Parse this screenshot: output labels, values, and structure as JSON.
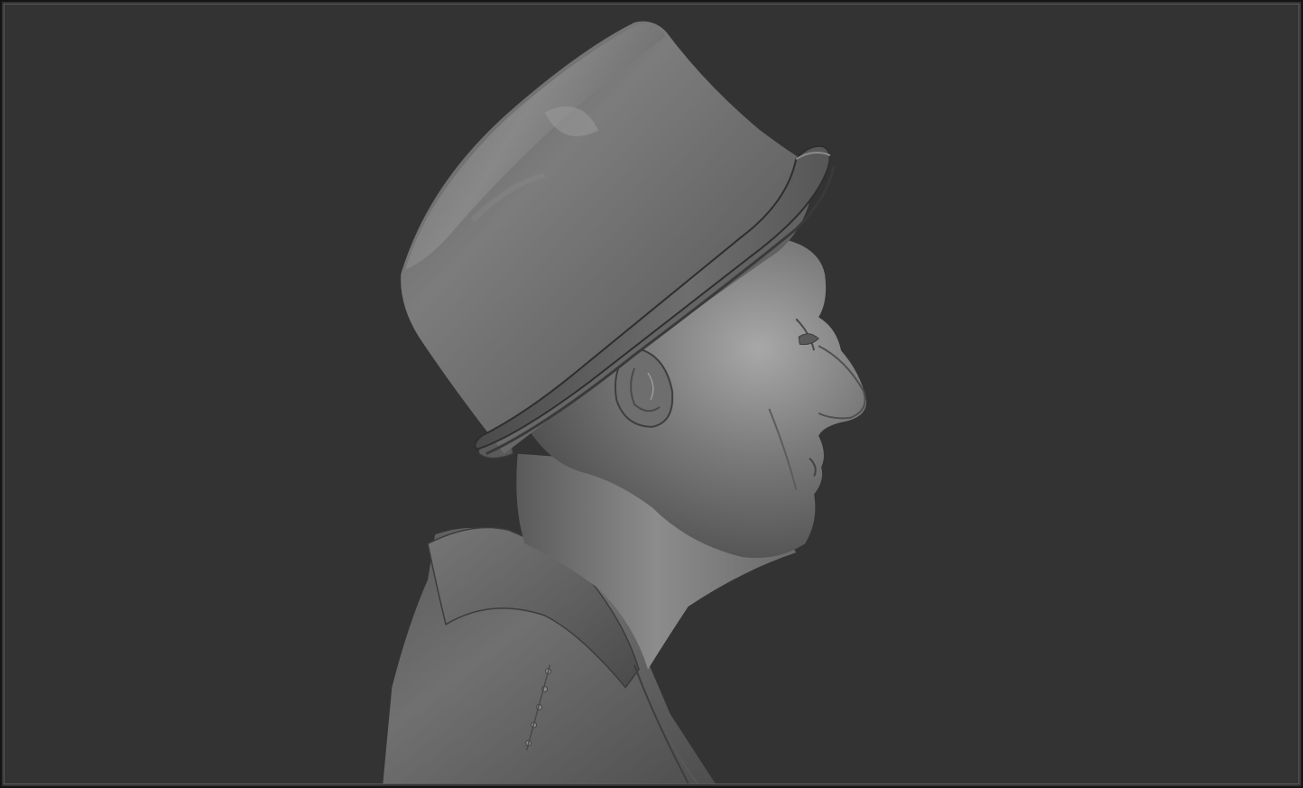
{
  "viewport": {
    "background_color": "#333333",
    "frame_border_color": "#5a5a5a"
  },
  "model": {
    "material_base_color": "#6e6e6e",
    "highlight_color": "#b0b0b0",
    "shadow_color": "#3a3a3a",
    "depicts": [
      "top-hat",
      "head-profile",
      "ear",
      "nose",
      "neck",
      "jacket-collar",
      "jacket-buttons"
    ]
  }
}
